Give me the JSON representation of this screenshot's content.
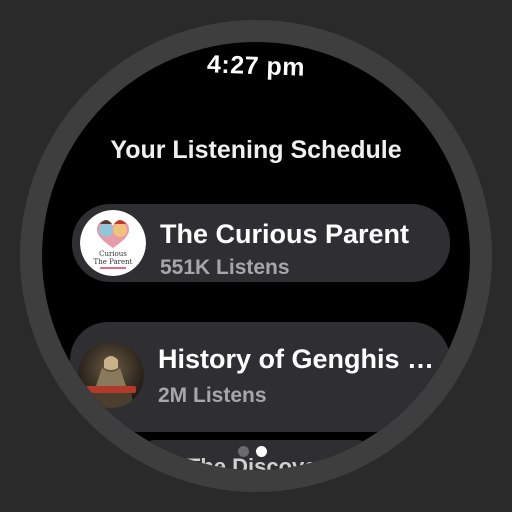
{
  "status": {
    "time": "4:27 pm"
  },
  "header": {
    "title": "Your Listening Schedule"
  },
  "items": [
    {
      "title": "The Curious Parent",
      "listens": "551K Listens",
      "art_icon": "curious-parent-cover",
      "art_text": [
        "Curious",
        "The Parent"
      ]
    },
    {
      "title": "History of Genghis Khan",
      "listens": "2M Listens",
      "art_icon": "genghis-khan-statue-cover"
    },
    {
      "title": "The Discover"
    }
  ],
  "pager": {
    "count": 2,
    "active": 2
  },
  "colors": {
    "background": "#2a2a2a",
    "bezel": "#3e3e3e",
    "screen": "#000000",
    "card": "#2f2f31",
    "subtitle": "#a7a7a7",
    "dot_active": "#ffffff",
    "dot_inactive": "#6b6b6b"
  }
}
